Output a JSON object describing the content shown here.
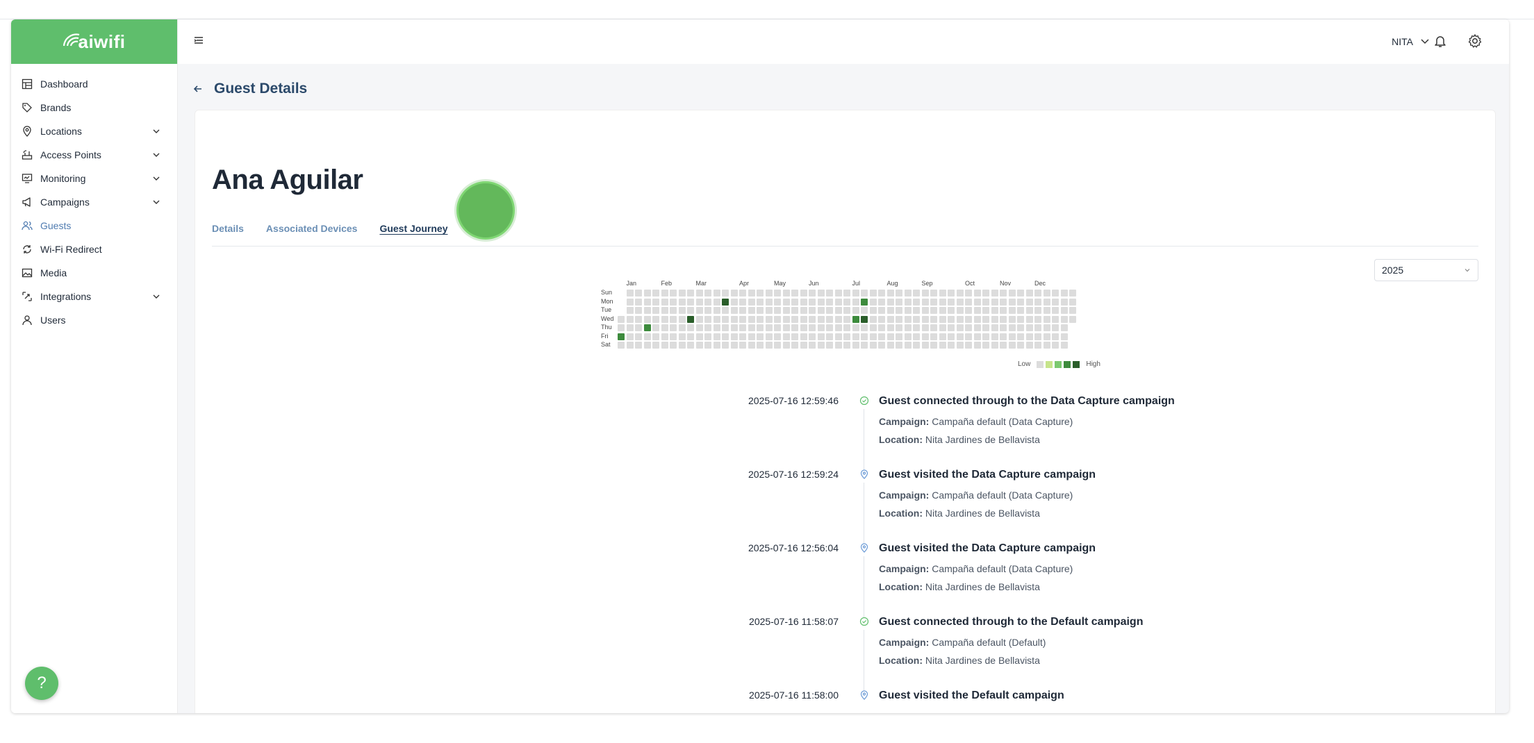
{
  "app": {
    "logo_text": "aiwifi"
  },
  "header": {
    "user": "NITA"
  },
  "sidebar": {
    "items": [
      {
        "label": "Dashboard",
        "icon": "dashboard-icon",
        "expandable": false,
        "active": false
      },
      {
        "label": "Brands",
        "icon": "tag-icon",
        "expandable": false,
        "active": false
      },
      {
        "label": "Locations",
        "icon": "map-pin-icon",
        "expandable": true,
        "active": false
      },
      {
        "label": "Access Points",
        "icon": "router-icon",
        "expandable": true,
        "active": false
      },
      {
        "label": "Monitoring",
        "icon": "monitor-icon",
        "expandable": true,
        "active": false
      },
      {
        "label": "Campaigns",
        "icon": "megaphone-icon",
        "expandable": true,
        "active": false
      },
      {
        "label": "Guests",
        "icon": "users-icon",
        "expandable": false,
        "active": true
      },
      {
        "label": "Wi-Fi Redirect",
        "icon": "redirect-icon",
        "expandable": false,
        "active": false
      },
      {
        "label": "Media",
        "icon": "image-icon",
        "expandable": false,
        "active": false
      },
      {
        "label": "Integrations",
        "icon": "integrations-icon",
        "expandable": true,
        "active": false
      },
      {
        "label": "Users",
        "icon": "user-icon",
        "expandable": false,
        "active": false
      }
    ],
    "help_label": "?"
  },
  "page": {
    "title": "Guest Details",
    "guest_name": "Ana Aguilar",
    "tabs": [
      {
        "label": "Details",
        "active": false
      },
      {
        "label": "Associated Devices",
        "active": false
      },
      {
        "label": "Guest Journey",
        "active": true
      }
    ],
    "year_select": {
      "value": "2025"
    }
  },
  "heatmap": {
    "months": [
      "Jan",
      "Feb",
      "Mar",
      "Apr",
      "May",
      "Jun",
      "Jul",
      "Aug",
      "Sep",
      "Oct",
      "Nov",
      "Dec"
    ],
    "days": [
      "Sun",
      "Mon",
      "Tue",
      "Wed",
      "Thu",
      "Fri",
      "Sat"
    ],
    "legend_low": "Low",
    "legend_high": "High",
    "colors": {
      "empty": "#dcdcdc",
      "l1": "#c6e48b",
      "l2": "#7bc96f",
      "l3": "#3d8b3d",
      "l4": "#2a5e2a"
    },
    "active_cells": [
      {
        "week": 0,
        "day": 5,
        "level": 3
      },
      {
        "week": 3,
        "day": 4,
        "level": 3
      },
      {
        "week": 8,
        "day": 3,
        "level": 4
      },
      {
        "week": 12,
        "day": 1,
        "level": 4
      },
      {
        "week": 27,
        "day": 3,
        "level": 3
      },
      {
        "week": 28,
        "day": 1,
        "level": 3
      },
      {
        "week": 28,
        "day": 3,
        "level": 4
      }
    ]
  },
  "timeline": {
    "campaign_label": "Campaign:",
    "location_label": "Location:",
    "events": [
      {
        "time": "2025-07-16 12:59:46",
        "type": "connected",
        "title": "Guest connected through to the Data Capture campaign",
        "campaign": "Campaña default (Data Capture)",
        "location": "Nita Jardines de Bellavista"
      },
      {
        "time": "2025-07-16 12:59:24",
        "type": "visited",
        "title": "Guest visited the Data Capture campaign",
        "campaign": "Campaña default (Data Capture)",
        "location": "Nita Jardines de Bellavista"
      },
      {
        "time": "2025-07-16 12:56:04",
        "type": "visited",
        "title": "Guest visited the Data Capture campaign",
        "campaign": "Campaña default (Data Capture)",
        "location": "Nita Jardines de Bellavista"
      },
      {
        "time": "2025-07-16 11:58:07",
        "type": "connected",
        "title": "Guest connected through to the Default campaign",
        "campaign": "Campaña default (Default)",
        "location": "Nita Jardines de Bellavista"
      },
      {
        "time": "2025-07-16 11:58:00",
        "type": "visited",
        "title": "Guest visited the Default campaign",
        "campaign": "",
        "location": ""
      }
    ]
  },
  "accent_color": "#5fbe6c"
}
